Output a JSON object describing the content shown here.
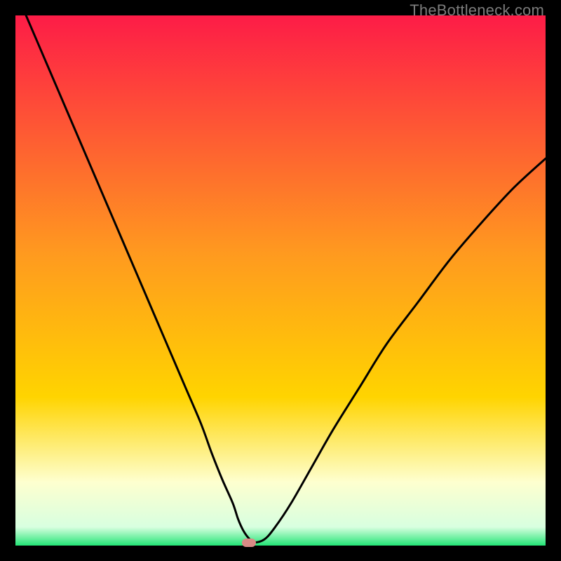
{
  "watermark": "TheBottleneck.com",
  "colors": {
    "top": "#fd1c47",
    "mid": "#ffd400",
    "pale": "#feffcf",
    "green": "#23e576",
    "curve": "#000000",
    "marker": "#d98b86",
    "frame": "#000000"
  },
  "chart_data": {
    "type": "line",
    "title": "",
    "xlabel": "",
    "ylabel": "",
    "xlim": [
      0,
      100
    ],
    "ylim": [
      0,
      100
    ],
    "gradient_stops": [
      {
        "pos": 0.0,
        "color": "#fd1c47"
      },
      {
        "pos": 0.45,
        "color": "#ff9a1f"
      },
      {
        "pos": 0.72,
        "color": "#ffd400"
      },
      {
        "pos": 0.88,
        "color": "#feffcf"
      },
      {
        "pos": 0.965,
        "color": "#d8ffe0"
      },
      {
        "pos": 1.0,
        "color": "#23e576"
      }
    ],
    "series": [
      {
        "name": "bottleneck-curve",
        "x": [
          2,
          5,
          8,
          11,
          14,
          17,
          20,
          23,
          26,
          29,
          32,
          35,
          37,
          39,
          41,
          42,
          43,
          44,
          45,
          47,
          49,
          52,
          56,
          60,
          65,
          70,
          76,
          82,
          88,
          94,
          100
        ],
        "y": [
          100,
          93,
          86,
          79,
          72,
          65,
          58,
          51,
          44,
          37,
          30,
          23,
          17.5,
          12.5,
          8,
          5,
          2.8,
          1.4,
          0.6,
          1.2,
          3.5,
          8,
          15,
          22,
          30,
          38,
          46,
          54,
          61,
          67.5,
          73
        ]
      }
    ],
    "marker": {
      "x": 44,
      "y": 0.5
    },
    "annotations": []
  }
}
